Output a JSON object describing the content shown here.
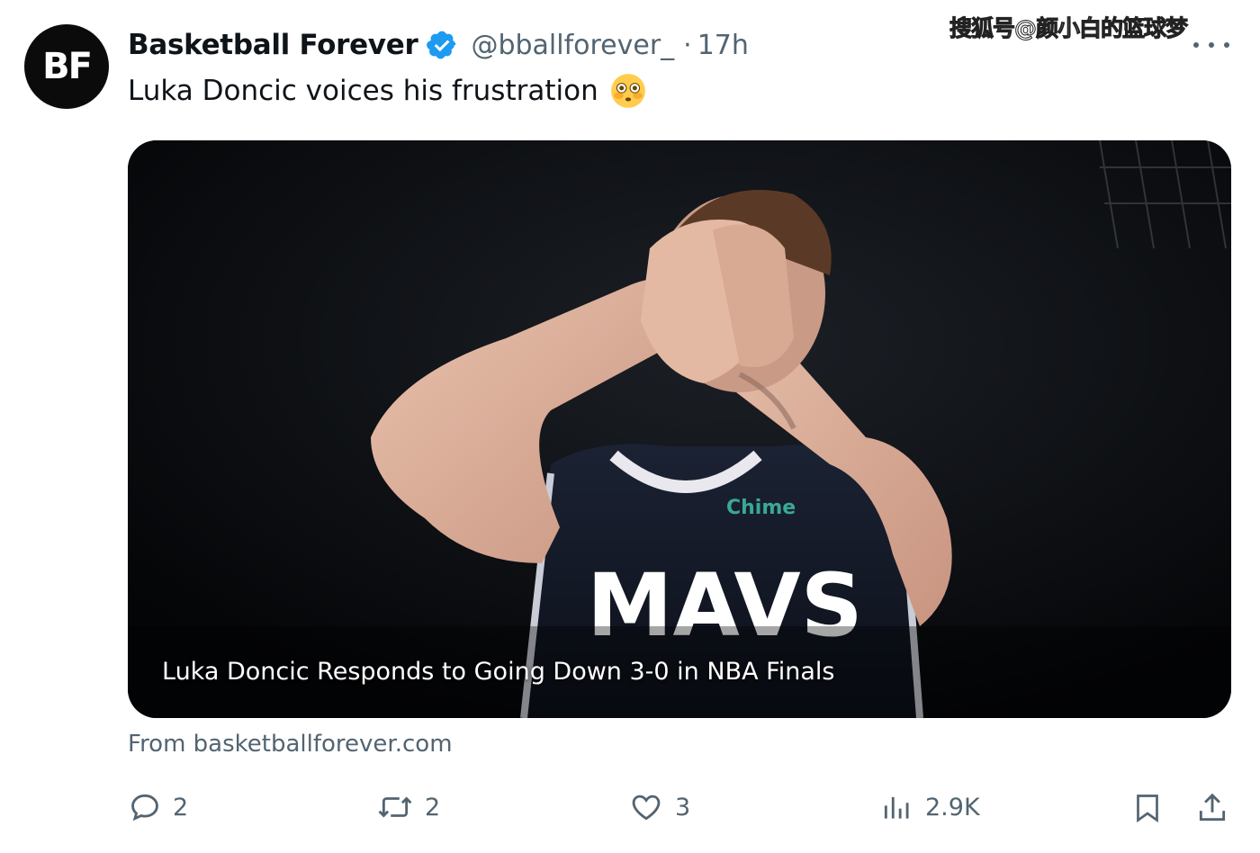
{
  "tweet": {
    "avatar_text": "BF",
    "author_name": "Basketball Forever",
    "handle": "@bballforever_",
    "separator": "·",
    "time": "17h",
    "text": "Luka Doncic voices his frustration",
    "emoji": "flushed-face",
    "watermark": "搜狐号@颜小白的篮球梦",
    "card": {
      "title": "Luka Doncic Responds to Going Down 3-0 in NBA Finals",
      "image_alt": "Player in MAVS jersey covering face with hands",
      "jersey_text": "MAVS",
      "sponsor_text": "Chime"
    },
    "source": "From basketballforever.com",
    "actions": {
      "replies": "2",
      "reposts": "2",
      "likes": "3",
      "views": "2.9K"
    }
  },
  "colors": {
    "verified": "#1d9bf0",
    "secondary_text": "#536471",
    "primary_text": "#0f1419"
  }
}
